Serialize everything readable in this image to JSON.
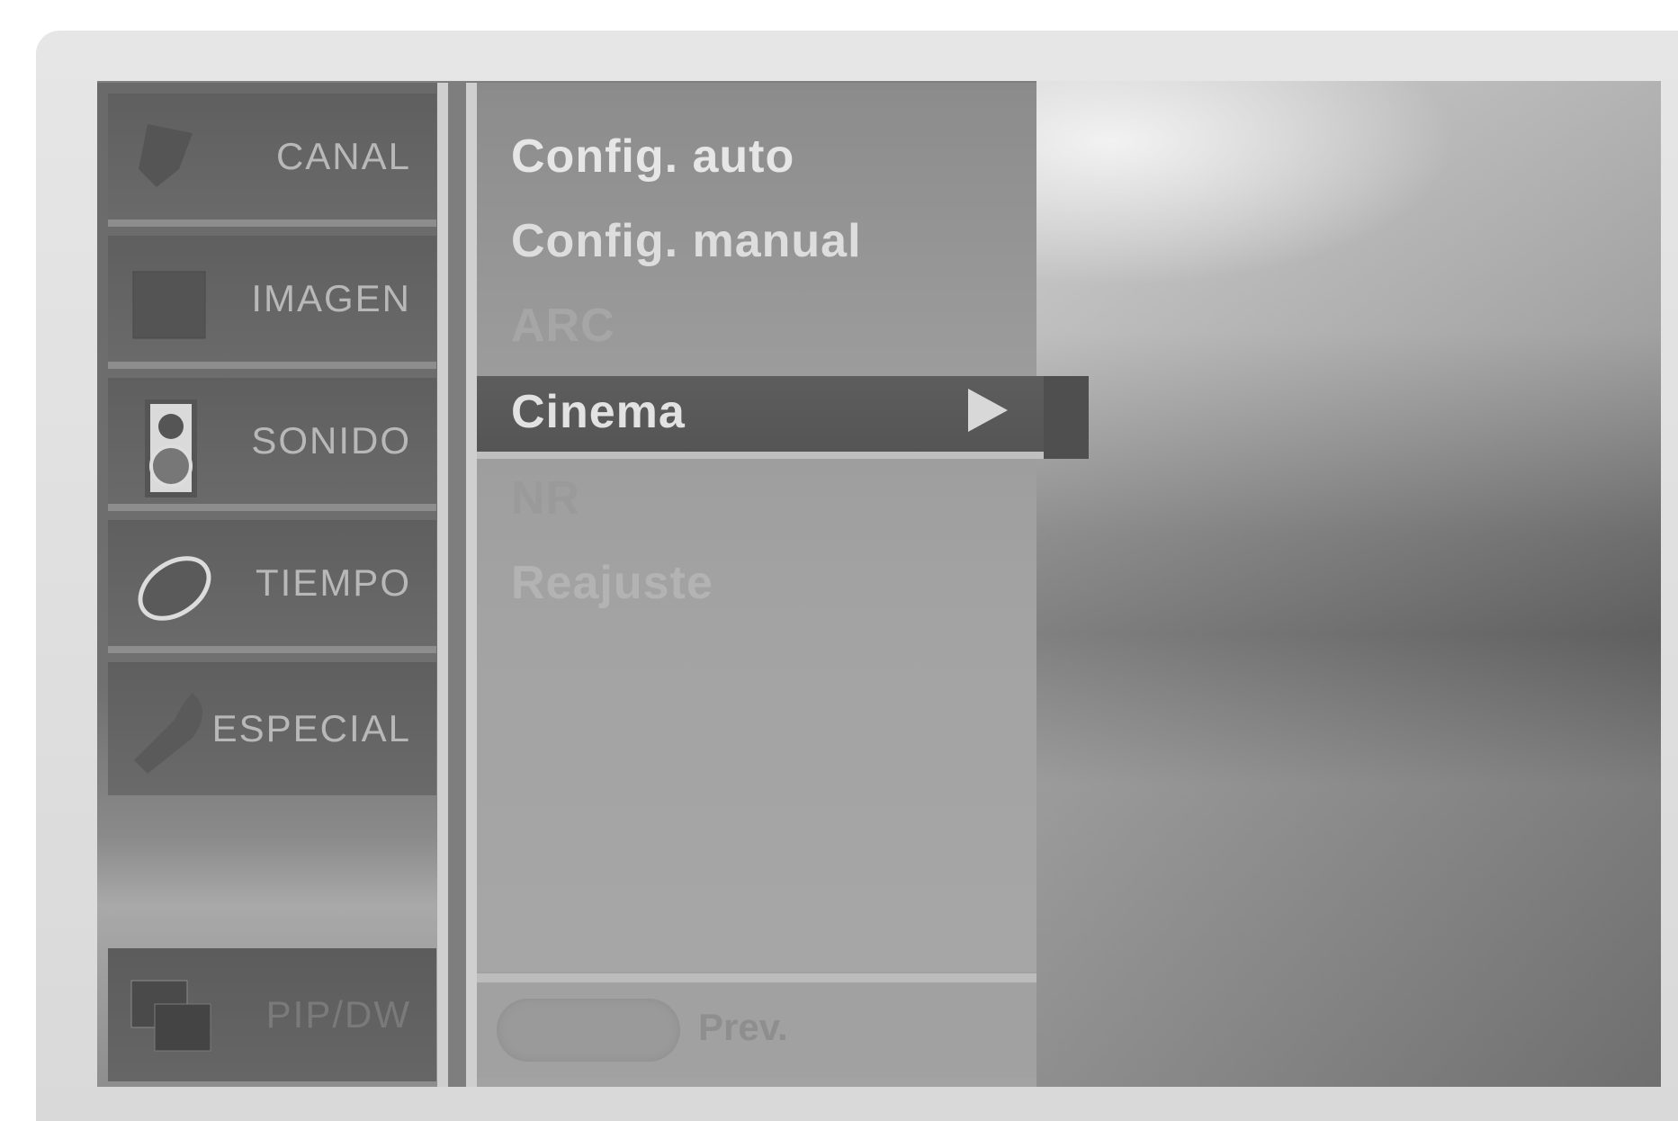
{
  "categories": [
    {
      "label": "CANAL",
      "icon": "satellite-dish-icon"
    },
    {
      "label": "IMAGEN",
      "icon": "picture-icon"
    },
    {
      "label": "SONIDO",
      "icon": "speaker-icon"
    },
    {
      "label": "TIEMPO",
      "icon": "clock-icon"
    },
    {
      "label": "ESPECIAL",
      "icon": "tool-icon"
    }
  ],
  "bottom_category": {
    "label": "PIP/DW",
    "icon": "pip-icon"
  },
  "submenu": {
    "items": [
      "Config. auto",
      "Config. manual",
      "ARC",
      "Cinema",
      "NR",
      "Reajuste"
    ],
    "selected": "Cinema"
  },
  "footer": {
    "prev_label": "Prev."
  }
}
